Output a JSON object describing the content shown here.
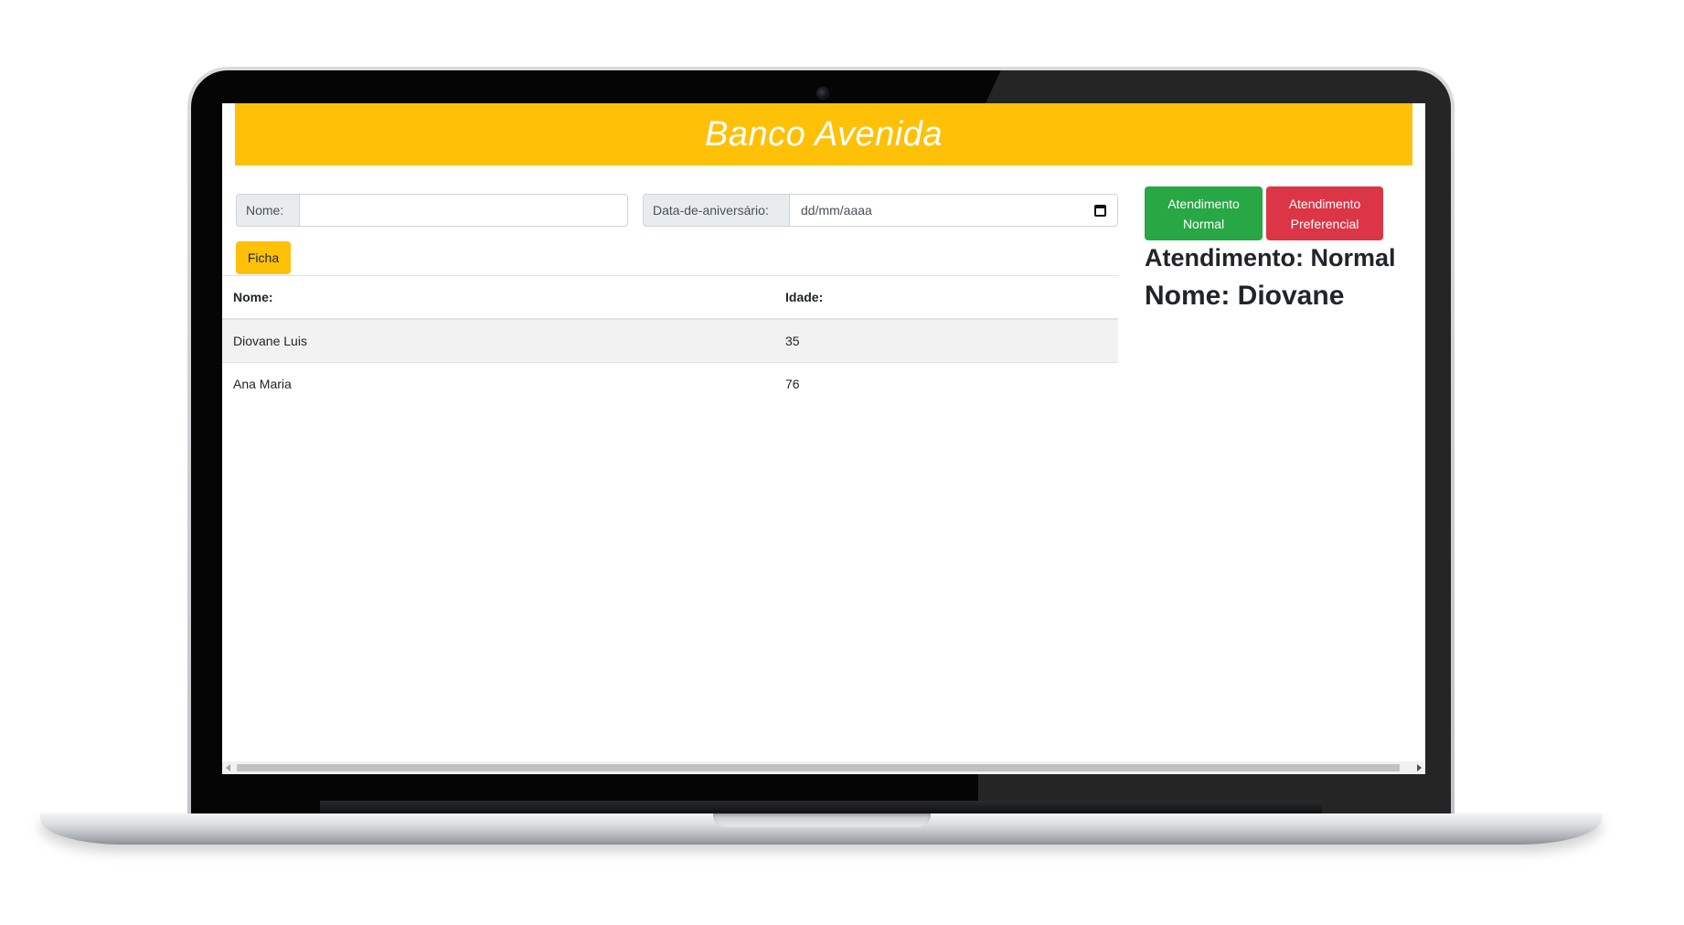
{
  "app": {
    "title": "Banco Avenida",
    "brand_color": "#ffc107"
  },
  "form": {
    "nome_label": "Nome:",
    "nome_value": "",
    "data_label": "Data-de-aniversário:",
    "data_placeholder": "dd/mm/aaaa",
    "calendar_icon": "calendar-icon",
    "ficha_button": "Ficha"
  },
  "table": {
    "columns": [
      "Nome:",
      "Idade:"
    ],
    "rows": [
      {
        "nome": "Diovane Luis",
        "idade": "35"
      },
      {
        "nome": "Ana Maria",
        "idade": "76"
      }
    ]
  },
  "queue": {
    "normal_button": "Atendimento Normal",
    "normal_color": "#28a745",
    "preferencial_button": "Atendimento Preferencial",
    "preferencial_color": "#dc3545",
    "atendimento_status": "Atendimento: Normal",
    "nome_status": "Nome: Diovane"
  }
}
